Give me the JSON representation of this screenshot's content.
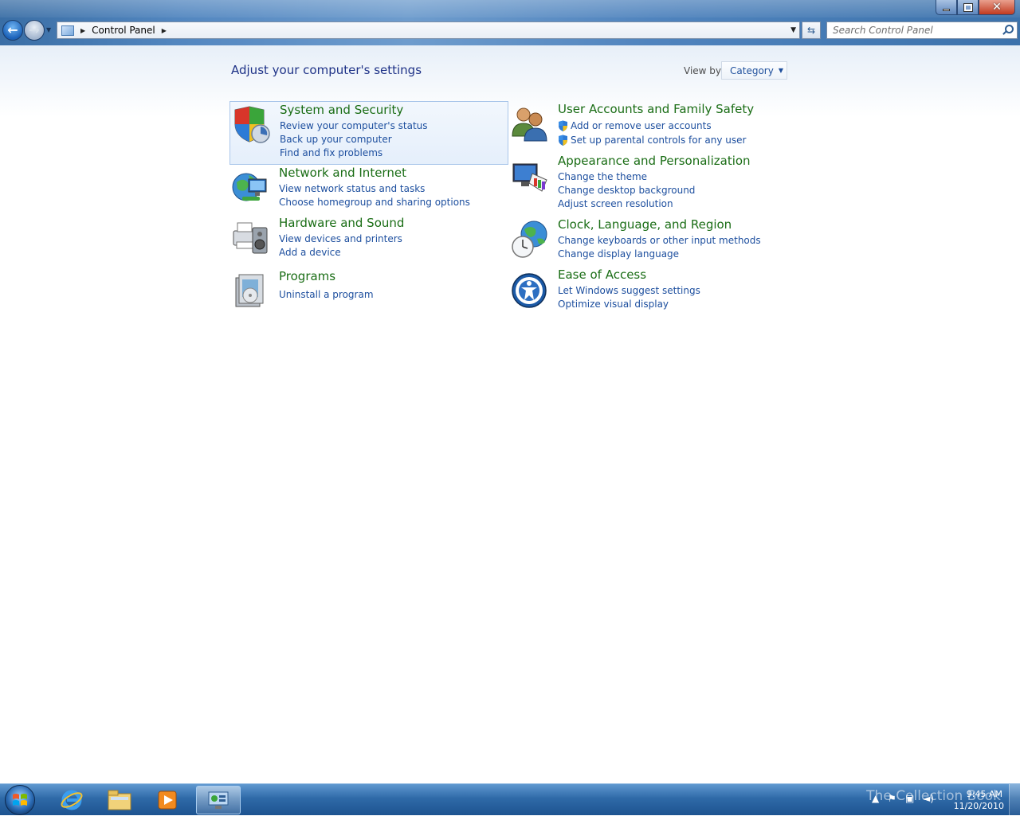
{
  "window": {
    "controls": {
      "minimize": "minimize",
      "maximize": "restore",
      "close": "close"
    }
  },
  "address": {
    "breadcrumb": "Control Panel"
  },
  "search": {
    "placeholder": "Search Control Panel"
  },
  "page": {
    "title": "Adjust your computer's settings",
    "view_by_label": "View by:",
    "view_by_value": "Category"
  },
  "categories": [
    {
      "title": "System and Security",
      "icon": "shield-icon",
      "links": [
        "Review your computer's status",
        "Back up your computer",
        "Find and fix problems"
      ]
    },
    {
      "title": "Network and Internet",
      "icon": "network-globe-icon",
      "links": [
        "View network status and tasks",
        "Choose homegroup and sharing options"
      ]
    },
    {
      "title": "Hardware and Sound",
      "icon": "printer-speaker-icon",
      "links": [
        "View devices and printers",
        "Add a device"
      ]
    },
    {
      "title": "Programs",
      "icon": "programs-icon",
      "links": [
        "Uninstall a program"
      ]
    },
    {
      "title": "User Accounts and Family Safety",
      "icon": "users-icon",
      "links": [
        "Add or remove user accounts",
        "Set up parental controls for any user"
      ]
    },
    {
      "title": "Appearance and Personalization",
      "icon": "monitor-palette-icon",
      "links": [
        "Change the theme",
        "Change desktop background",
        "Adjust screen resolution"
      ]
    },
    {
      "title": "Clock, Language, and Region",
      "icon": "clock-globe-icon",
      "links": [
        "Change keyboards or other input methods",
        "Change display language"
      ]
    },
    {
      "title": "Ease of Access",
      "icon": "ease-of-access-icon",
      "links": [
        "Let Windows suggest settings",
        "Optimize visual display"
      ]
    }
  ],
  "taskbar": {
    "pinned": [
      "internet-explorer-icon",
      "windows-explorer-icon",
      "media-player-icon",
      "control-panel-icon"
    ],
    "watermark": "The Collection Book",
    "time": "9:45 AM",
    "date": "11/20/2010"
  },
  "colors": {
    "title_blue": "#1e3287",
    "category_green": "#1a6d15",
    "link_blue": "#1c4e9e",
    "taskbar": "#2f6aa8"
  }
}
